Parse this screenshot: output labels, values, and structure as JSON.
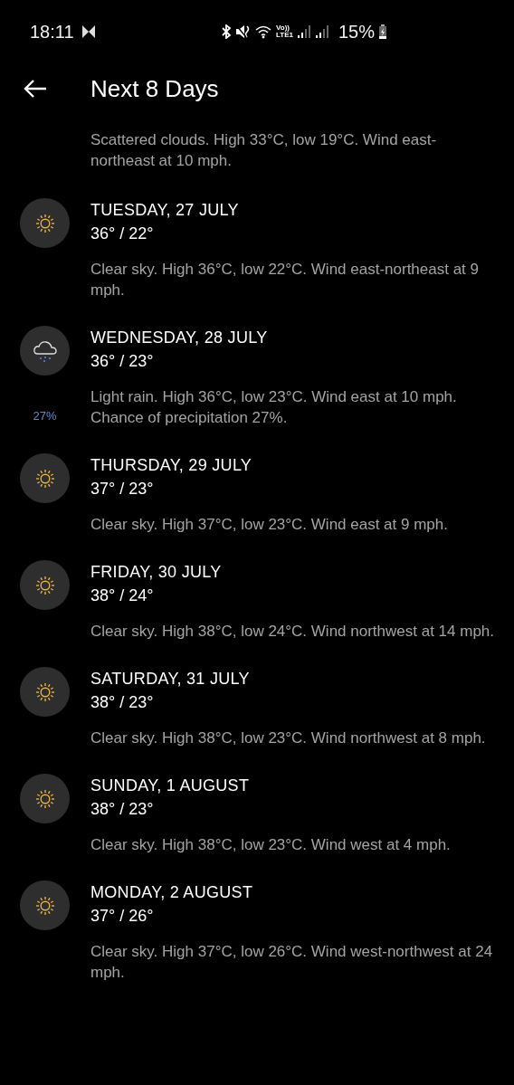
{
  "status_bar": {
    "time": "18:11",
    "volte": "Vo))",
    "network": "LTE1",
    "battery": "15%"
  },
  "header": {
    "title": "Next 8 Days"
  },
  "intro": "Scattered clouds. High 33°C, low 19°C. Wind east-northeast at 10 mph.",
  "days": [
    {
      "kind": "sun",
      "date": "TUESDAY, 27 JULY",
      "temps": "36° / 22°",
      "description": "Clear sky. High 36°C, low 22°C. Wind east-northeast at 9 mph."
    },
    {
      "kind": "rain",
      "date": "WEDNESDAY, 28 JULY",
      "temps": "36° / 23°",
      "precipitation": "27%",
      "description": "Light rain. High 36°C, low 23°C. Wind east at 10 mph. Chance of precipitation 27%."
    },
    {
      "kind": "sun",
      "date": "THURSDAY, 29 JULY",
      "temps": "37° / 23°",
      "description": "Clear sky. High 37°C, low 23°C. Wind east at 9 mph."
    },
    {
      "kind": "sun",
      "date": "FRIDAY, 30 JULY",
      "temps": "38° / 24°",
      "description": "Clear sky. High 38°C, low 24°C. Wind northwest at 14 mph."
    },
    {
      "kind": "sun",
      "date": "SATURDAY, 31 JULY",
      "temps": "38° / 23°",
      "description": "Clear sky. High 38°C, low 23°C. Wind northwest at 8 mph."
    },
    {
      "kind": "sun",
      "date": "SUNDAY, 1 AUGUST",
      "temps": "38° / 23°",
      "description": "Clear sky. High 38°C, low 23°C. Wind west at 4 mph."
    },
    {
      "kind": "sun",
      "date": "MONDAY, 2 AUGUST",
      "temps": "37° / 26°",
      "description": "Clear sky. High 37°C, low 26°C. Wind west-northwest at 24 mph."
    }
  ]
}
